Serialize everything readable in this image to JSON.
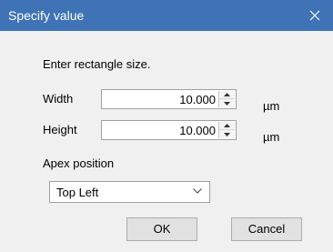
{
  "dialog": {
    "title": "Specify value",
    "prompt": "Enter rectangle size.",
    "width": {
      "label": "Width",
      "value": "10.000",
      "unit": "µm"
    },
    "height": {
      "label": "Height",
      "value": "10.000",
      "unit": "µm"
    },
    "apex": {
      "label": "Apex position",
      "selected": "Top Left"
    },
    "ok_label": "OK",
    "cancel_label": "Cancel",
    "icons": {
      "close": "close-icon",
      "spin_up": "arrow-up-icon",
      "spin_down": "arrow-down-icon",
      "dropdown": "chevron-down-icon"
    },
    "colors": {
      "titlebar": "#3f73b5",
      "background": "#f0f0f0",
      "button": "#e1e1e1"
    }
  }
}
